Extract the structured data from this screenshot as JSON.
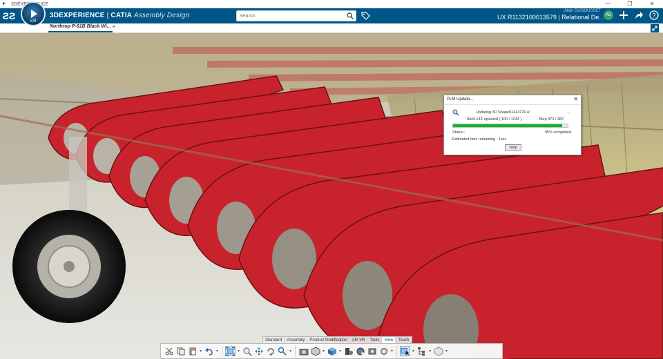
{
  "window": {
    "title": "3DEXPERIENCE",
    "controls": [
      "—",
      "❐",
      "✕"
    ]
  },
  "header": {
    "brand_strong": "3DEXPERIENCE",
    "brand_separator": " | ",
    "brand_app": "CATIA",
    "brand_role": " Assembly Design",
    "compass_label": "V,R",
    "search_placeholder": "Search",
    "user_name": "Alain DUGOUSSET",
    "context": "UX R1132100013579 | Relational De...",
    "avatar_text": "AD"
  },
  "tabs": {
    "active_label": "Northrop P-61B Black Wi...",
    "plus": "+"
  },
  "dialog": {
    "title": "PLM Update...",
    "close": "✕",
    "line1": "Updating 3D Shape01424729 A '",
    "line1_suffix": "...",
    "line2": "' Shell.143' updated ( 100 / 1243 )",
    "line2_step": "-   Step 372 / 387",
    "progress": 0.95,
    "status_label": "Status :",
    "status_value": "95% completed",
    "eta_label": "Estimated time remaining :  1sec",
    "stop_label": "Stop",
    "accent": "#11b530"
  },
  "actionbar": {
    "tabs": [
      "Standard",
      "Assembly",
      "Product Modification",
      "AR-VR",
      "Tools",
      "View",
      "Touch"
    ],
    "active_tab": "View"
  },
  "colors": {
    "header": "#005686",
    "rib_red": "#c8232c",
    "frame_yellow": "#d9cf7a"
  }
}
